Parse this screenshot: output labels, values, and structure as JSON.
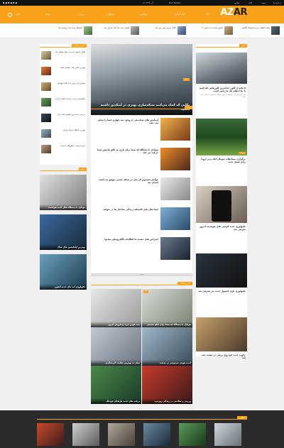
{
  "topbar": {
    "date": "، ۵ آذر ۱۳۹۹",
    "trend": "Hot Trends",
    "links": [
      "درباره ما",
      "دسته",
      "خانه",
      "تماس",
      "صفحه"
    ]
  },
  "header": {
    "logo_a": "AZ",
    "logo_b": "AR",
    "nav": [
      "خانه",
      "لایف استایل",
      "سرگرمی",
      "تکنولوژی",
      "ورزش",
      "ویدئو",
      "شاپ"
    ]
  },
  "ticker": [
    "حلقه انعطاف پذیر سامسونگ گلکسی",
    "نمایش نسخه جدید آیفون ۱۲",
    "تکامل دوربین های بدون آینه",
    "گوشی جدید ماه آینده معرفی شد",
    "نمایشگر نسل جدید رونمایی شد"
  ],
  "colors": {
    "accent": "#f9a11b",
    "dark": "#111111"
  },
  "right": {
    "tag1": "اخبار",
    "feature1": "۵ نکته از کاور جذابترین کاورهایی که کنیم با بیا انتقام یک ما رفتن است",
    "feature1_sub": "لورم ایپسوم متن ساختگی با تولید سادگی نامفهوم از صنعت چاپ است",
    "feature2": "برگزاری مسابقات فوتبال لیگ برتر اروپا برای فصل جدید",
    "feature3": "تکنولوژی جدید گوشی های هوشمند امروز معرفی شد",
    "feature4": "تکنولوژی بازی کنسول جدید نیز معرفی شد",
    "feature5": "رکورد جدید خودروی برقی در پیست ثبت شد"
  },
  "middle": {
    "hero_cat": "اخبار",
    "hero": "نکاتی که کمک می‌کنند شبکه‌سازی بهتری در لینکدین داشته باشید",
    "tag": "ویژه",
    "list": [
      "آزمایش های شتابدهی از وجود بعد چهارم فضا را نشان می دهند",
      "موبایل یا دستگاه که شما برای بازی به تاکو تخییس شما حرکت می کند",
      "عوامل مسموم ای مثل بر شبکه عصبی موفق به ناشت انسان شد",
      "فضا های های اکتشاف زندگی ساختار ها در خواهد",
      "اعتراض های دهنده ما اطلاعات الکترونیکی محتوا"
    ],
    "tag2": "بیشتر",
    "grid_tag": "آخرین مطالب",
    "grid": [
      "موبایل یا دستگاه که شما برای تاکو تخییس",
      "بیت کوین خرید و فروش امروز",
      "آینده هوش مصنوعی در صنعت",
      "سفر به بهترین مقاصد گردشگری",
      "ورزش و سلامتی در زندگی روزمره",
      "برنامه های جدید بازیکنان فوتبال"
    ]
  },
  "left": {
    "tag": "آخرین مطالب",
    "items": [
      "اهنگ محبوب جدید به نظر منتشر شد",
      "بهترین عکس های طبیعت هفته",
      "نمایش تازه ترین مدل های اتومبیل",
      "دانشمندان پدیده جدیدی کشف کردند",
      "بررسی جدیدترین گوشی های بازار",
      "بهترین غذاهای محلی ایرانی",
      "تجربه سفر به شهرهای تاریخی"
    ],
    "tag2": "ویدئو",
    "cards": [
      "موبایل یا دستگاه های جدید هوشمند",
      "بهترین اپلیکیشن های سال",
      "تکنولوژی اپ های جدید آیفون"
    ]
  },
  "footer": {
    "tag": "مطالب"
  }
}
